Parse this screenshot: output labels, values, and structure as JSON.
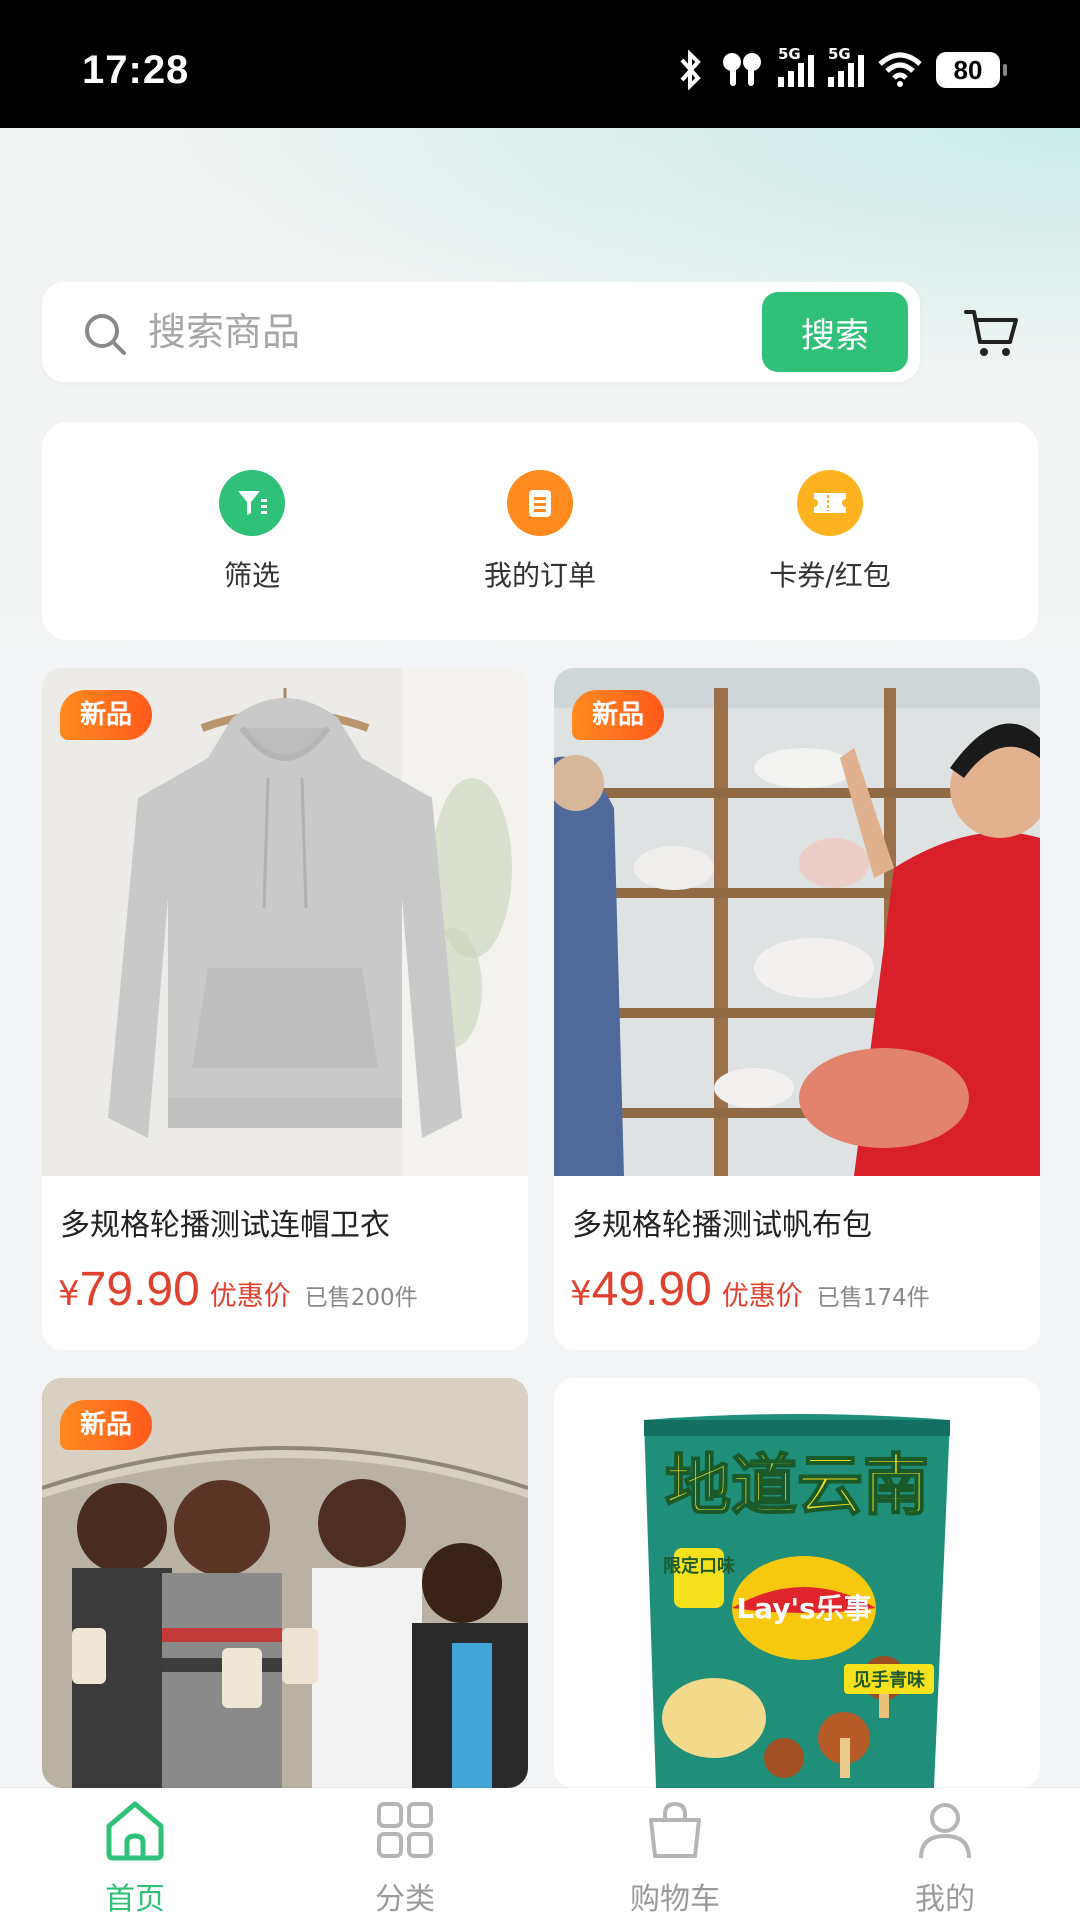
{
  "status_bar": {
    "time": "17:28",
    "net1": "5G",
    "net2": "5G",
    "battery": "80"
  },
  "search": {
    "placeholder": "搜索商品",
    "button_label": "搜索"
  },
  "quick_actions": [
    {
      "label": "筛选",
      "icon": "filter-icon",
      "color": "#2fc178"
    },
    {
      "label": "我的订单",
      "icon": "order-list-icon",
      "color": "#ff8a1f"
    },
    {
      "label": "卡券/红包",
      "icon": "coupon-icon",
      "color": "#ffb21f"
    }
  ],
  "products": [
    {
      "badge": "新品",
      "title": "多规格轮播测试连帽卫衣",
      "currency": "¥",
      "price": "79.90",
      "price_tag": "优惠价",
      "sold": "已售200件",
      "image": "grey hoodie on hanger"
    },
    {
      "badge": "新品",
      "title": "多规格轮播测试帆布包",
      "currency": "¥",
      "price": "49.90",
      "price_tag": "优惠价",
      "sold": "已售174件",
      "image": "people examining coral specimens"
    },
    {
      "badge": "新品",
      "title": "",
      "image": "children holding sample bags"
    },
    {
      "badge": "",
      "title": "",
      "image": "Lay's potato chips bag",
      "pack_text": {
        "headline": "地道云南",
        "limited": "限定口味",
        "brand": "Lay's乐事",
        "flavor": "见手青味"
      }
    }
  ],
  "bottom_nav": [
    {
      "label": "首页",
      "icon": "home-icon",
      "active": true
    },
    {
      "label": "分类",
      "icon": "category-icon",
      "active": false
    },
    {
      "label": "购物车",
      "icon": "shopping-bag-icon",
      "active": false
    },
    {
      "label": "我的",
      "icon": "profile-icon",
      "active": false
    }
  ],
  "colors": {
    "accent": "#2fc178",
    "price": "#e0412e",
    "badge": "#ff6a1c"
  }
}
